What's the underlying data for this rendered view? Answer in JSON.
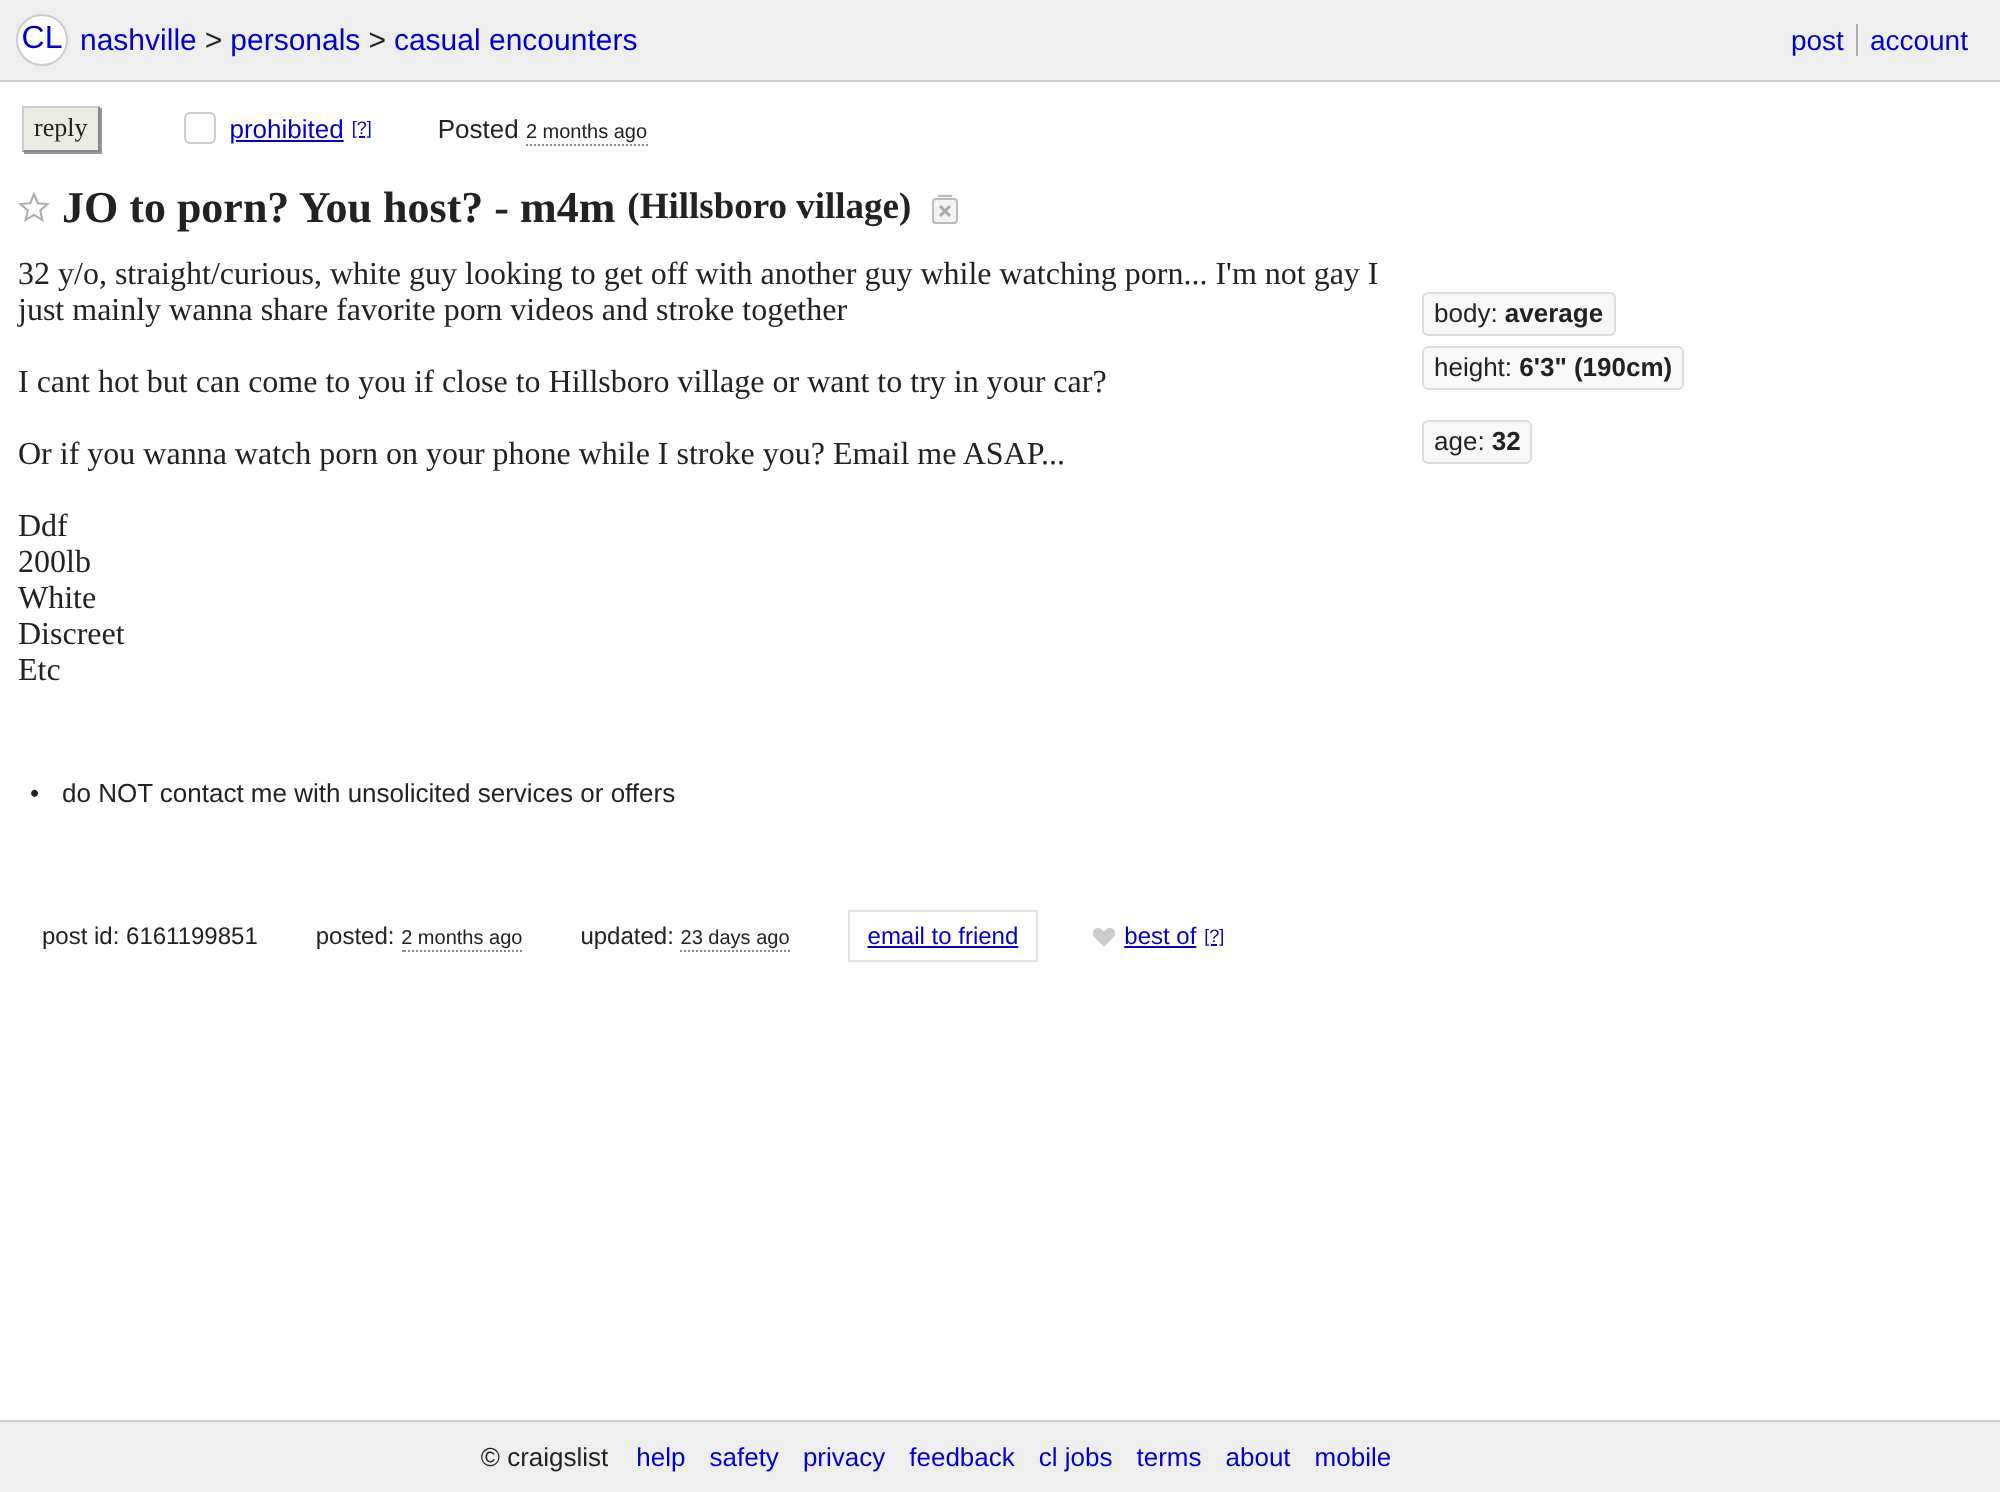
{
  "header": {
    "logo": "CL",
    "breadcrumbs": [
      "nashville",
      "personals",
      "casual encounters"
    ],
    "separators": [
      ">",
      ">"
    ],
    "nav": [
      "post",
      "account"
    ]
  },
  "actions": {
    "reply": "reply",
    "flag": {
      "checked": false,
      "label": "prohibited",
      "help": "[?]"
    },
    "posted": {
      "label": "Posted",
      "time": "2 months ago"
    }
  },
  "title": {
    "favorite": false,
    "text": "JO to porn? You host? - m4m",
    "location": "(Hillsboro village)"
  },
  "body": {
    "paragraphs": [
      [
        "32 y/o, straight/curious, white guy looking to get off with another guy while watching porn... I'm not gay I just mainly wanna share favorite porn videos and stroke together"
      ],
      [
        "I cant hot but can come to you if close to Hillsboro village or want to try in your car?"
      ],
      [
        "Or if you wanna watch porn on your phone while I stroke you? Email me ASAP..."
      ],
      [
        "Ddf",
        "200lb",
        "White",
        "Discreet",
        "Etc"
      ]
    ]
  },
  "attributes": [
    [
      "body: **average**",
      "height: **6'3\" (190cm)**"
    ],
    [
      "age: **32**"
    ]
  ],
  "notices": [
    {
      "marker": "•",
      "text": "do NOT contact me with unsolicited services or offers"
    }
  ],
  "post_info": {
    "post_id": "post id: 6161199851",
    "posted": {
      "label": "posted:",
      "time": "2 months ago"
    },
    "updated": {
      "label": "updated:",
      "time": "23 days ago"
    },
    "email": "email to friend",
    "best_of": {
      "favorited": false,
      "label": "best of",
      "help": "[?]"
    }
  },
  "footer": {
    "copyright": "© craigslist",
    "links": [
      "help",
      "safety",
      "privacy",
      "feedback",
      "cl jobs",
      "terms",
      "about",
      "mobile"
    ]
  }
}
